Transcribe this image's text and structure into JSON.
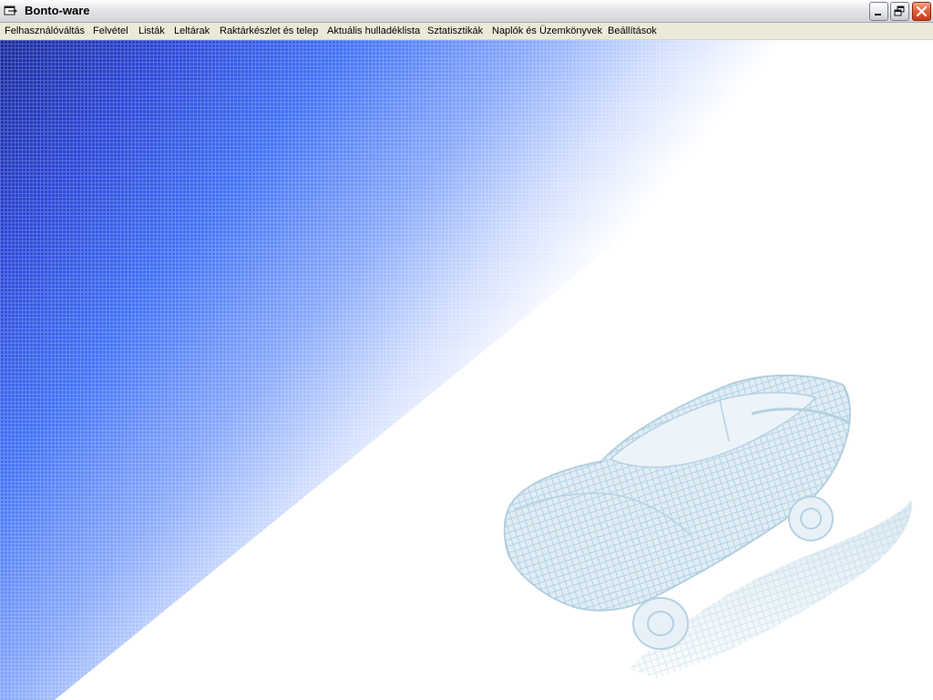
{
  "window": {
    "title": "Bonto-ware",
    "icon": "app-window-icon",
    "controls": {
      "minimize_icon": "minimize-icon",
      "restore_icon": "restore-icon",
      "close_icon": "close-icon"
    }
  },
  "menu": {
    "items": [
      {
        "label": "Felhasználóváltás"
      },
      {
        "label": "Felvétel"
      },
      {
        "label": "Listák"
      },
      {
        "label": "Leltárak"
      },
      {
        "label": "Raktárkészlet és telep"
      },
      {
        "label": "Aktuális hulladéklista"
      },
      {
        "label": "Sztatisztikák"
      },
      {
        "label": "Naplók és Üzemkönyvek"
      },
      {
        "label": "Beállítások"
      }
    ]
  },
  "background": {
    "gradient_dark": "#1a2a9c",
    "gradient_mid": "#3f6ff5",
    "gradient_light": "#ffffff",
    "watermark": "car-wireframe-image",
    "watermark_color": "#bcd6e6"
  }
}
